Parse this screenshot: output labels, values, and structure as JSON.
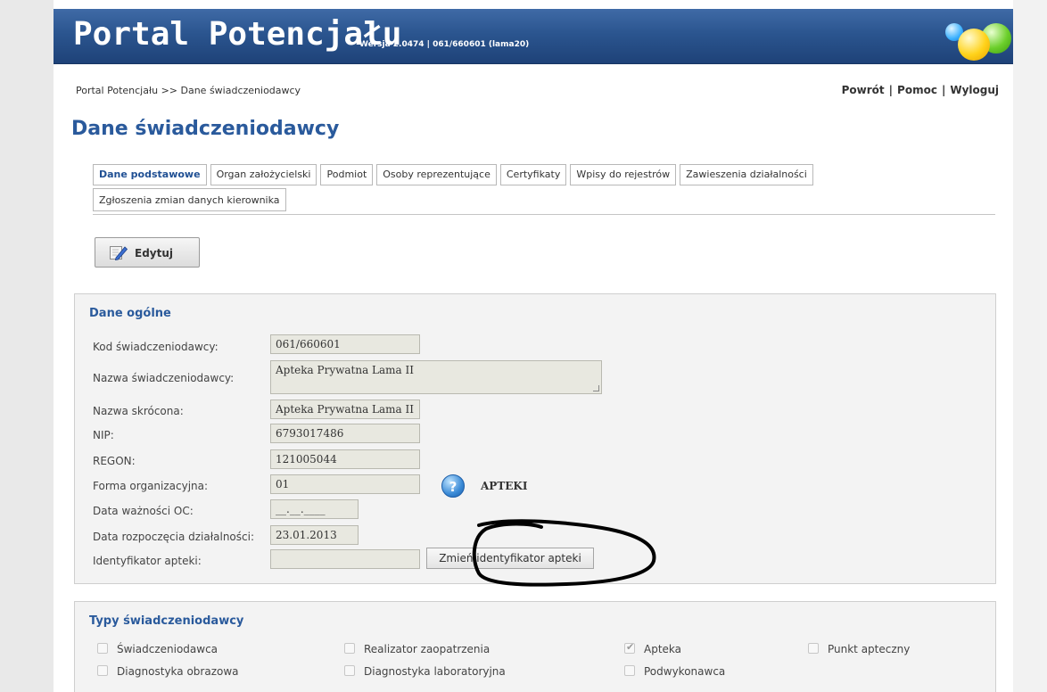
{
  "header": {
    "title": "Portal Potencjału",
    "version": "Wersja 2.0474 | 061/660601 (lama20)"
  },
  "breadcrumb": "Portal Potencjału >> Dane świadczeniodawcy",
  "toplinks": {
    "back": "Powrót",
    "help": "Pomoc",
    "logout": "Wyloguj",
    "separator": "|"
  },
  "page_title": "Dane świadczeniodawcy",
  "tabs": [
    {
      "label": "Dane podstawowe",
      "active": true
    },
    {
      "label": "Organ założycielski"
    },
    {
      "label": "Podmiot"
    },
    {
      "label": "Osoby reprezentujące"
    },
    {
      "label": "Certyfikaty"
    },
    {
      "label": "Wpisy do rejestrów"
    },
    {
      "label": "Zawieszenia działalności"
    },
    {
      "label": "Zgłoszenia zmian danych kierownika"
    }
  ],
  "edit_button": {
    "label": "Edytuj",
    "icon": "edit-pencil-icon"
  },
  "general": {
    "heading": "Dane ogólne",
    "fields": [
      {
        "label": "Kod świadczeniodawcy:",
        "value": "061/660601"
      },
      {
        "label": "Nazwa świadczeniodawcy:",
        "value": "Apteka Prywatna Lama II"
      },
      {
        "label": "Nazwa skrócona:",
        "value": "Apteka Prywatna Lama II"
      },
      {
        "label": "NIP:",
        "value": "6793017486"
      },
      {
        "label": "REGON:",
        "value": "121005044"
      },
      {
        "label": "Forma organizacyjna:",
        "value": "01"
      },
      {
        "label": "Data ważności OC:",
        "value": "__.__.____"
      },
      {
        "label": "Data rozpoczęcia działalności:",
        "value": "23.01.2013"
      },
      {
        "label": "Identyfikator apteki:",
        "value": ""
      }
    ],
    "help_icon": "?",
    "forma_desc": "APTEKI",
    "change_button": "Zmień identyfikator apteki"
  },
  "types": {
    "heading": "Typy świadczeniodawcy",
    "items": [
      {
        "label": "Świadczeniodawca",
        "checked": false
      },
      {
        "label": "Realizator zaopatrzenia",
        "checked": false
      },
      {
        "label": "Apteka",
        "checked": true
      },
      {
        "label": "Punkt apteczny",
        "checked": false
      },
      {
        "label": "Diagnostyka obrazowa",
        "checked": false
      },
      {
        "label": "Diagnostyka laboratoryjna",
        "checked": false
      },
      {
        "label": "Podwykonawca",
        "checked": false
      }
    ]
  }
}
